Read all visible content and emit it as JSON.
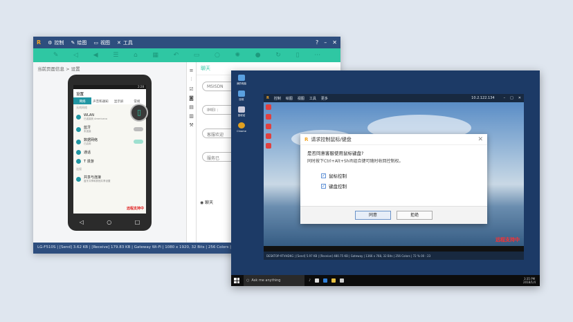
{
  "win1": {
    "menu": [
      {
        "icon": "control-icon",
        "label": "控制"
      },
      {
        "icon": "draw-icon",
        "label": "绘图"
      },
      {
        "icon": "view-icon",
        "label": "视图"
      },
      {
        "icon": "tools-icon",
        "label": "工具"
      }
    ],
    "breadcrumb": "当前页面信息 > 设置",
    "phone": {
      "time": "2:28",
      "app_title": "设置",
      "tabs": [
        "网络",
        "声音和通知",
        "显示屏",
        "常规"
      ],
      "section_network": "无线网络",
      "rows": [
        {
          "title": "WLAN",
          "sub": "已连接到 Americano"
        },
        {
          "title": "蓝牙",
          "sub": "未连接"
        },
        {
          "title": "数据网络",
          "sub": "已启用"
        },
        {
          "title": "通话",
          "sub": ""
        },
        {
          "title": "T 漫游",
          "sub": ""
        }
      ],
      "section_share": "连接",
      "share_row": {
        "title": "共享与连接",
        "sub": "蓝牙共享和其他共享设置"
      },
      "remote_label": "远程支持中"
    },
    "chat": {
      "header": "聊天",
      "pills": [
        "MSISDN",
        "IMEI :",
        "客服欢迎",
        "服务已"
      ],
      "tab": "聊天"
    },
    "status": "LG-F510S | [Send] 3.62 KB | [Receive] 179.83 KB | Gateway Wi-Fi | 1080 x 1920, 32 Bits | 256 Colors | 2..."
  },
  "win2": {
    "desktop_icons": [
      "我的电脑",
      "回收",
      "回收站",
      "Chrome"
    ],
    "menu": [
      "控制",
      "绘图",
      "视图",
      "工具",
      "更多"
    ],
    "ip": "10.2.122.134",
    "remote_label": "远程支持中",
    "status": "DESKTOP-9TVHDKG | [Send] 5.97 KB | [Receive] 480.75 KB | Gateway | 1366 x 768, 32 Bits | 256 Colors | 72 %",
    "elapsed": "00 : 23",
    "dialog": {
      "title": "请求控制鼠标/键盘",
      "question": "是否同意客服使用鼠标键盘?",
      "hint": "同时按下Ctrl+Alt+Shift组合键可随时收回控制权。",
      "check_mouse": "鼠标控制",
      "check_keyboard": "键盘控制",
      "agree": "同意",
      "reject": "拒绝"
    },
    "taskbar": {
      "search": "Ask me anything",
      "time": "3:35 PM",
      "date": "2018/1/4"
    }
  }
}
